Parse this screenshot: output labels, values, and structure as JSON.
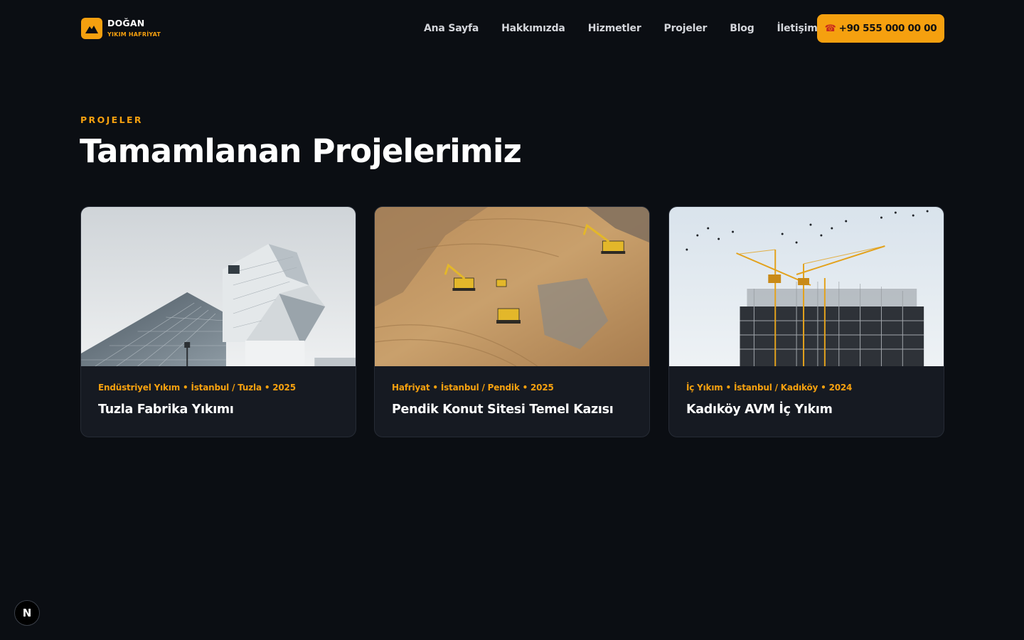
{
  "header": {
    "logo": {
      "title": "DOĞAN",
      "subtitle": "YIKIM HAFRİYAT",
      "icon": "mountain-icon"
    },
    "nav": [
      {
        "label": "Ana Sayfa"
      },
      {
        "label": "Hakkımızda"
      },
      {
        "label": "Hizmetler"
      },
      {
        "label": "Projeler"
      },
      {
        "label": "Blog"
      },
      {
        "label": "İletişim"
      }
    ],
    "cta": {
      "icon": "☎",
      "label": "+90 555 000 00 00"
    }
  },
  "section": {
    "eyebrow": "PROJELER",
    "title": "Tamamlanan Projelerimiz"
  },
  "projects": [
    {
      "meta": "Endüstriyel Yıkım • İstanbul / Tuzla • 2025",
      "title": "Tuzla Fabrika Yıkımı"
    },
    {
      "meta": "Hafriyat • İstanbul / Pendik • 2025",
      "title": "Pendik Konut Sitesi Temel Kazısı"
    },
    {
      "meta": "İç Yıkım • İstanbul / Kadıköy • 2024",
      "title": "Kadıköy AVM İç Yıkım"
    }
  ],
  "badge": {
    "label": "N"
  },
  "colors": {
    "accent": "#f5a00f",
    "background": "#0b0e13",
    "card": "#161a22"
  }
}
